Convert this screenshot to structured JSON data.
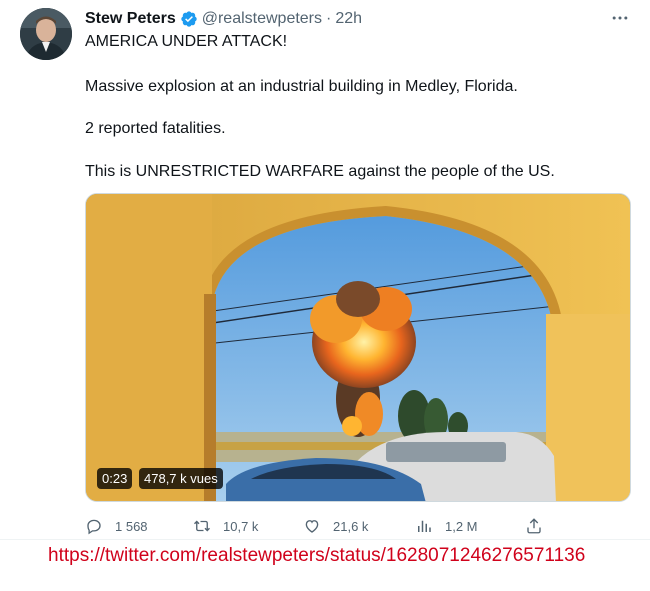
{
  "tweet": {
    "author_name": "Stew Peters",
    "handle": "@realstewpeters",
    "separator": "·",
    "time": "22h",
    "verified": true,
    "lines": [
      "AMERICA UNDER ATTACK!",
      "Massive explosion at an industrial building in Medley, Florida.",
      "2 reported fatalities.",
      "This is UNRESTRICTED WARFARE against the people of the US."
    ],
    "video": {
      "duration": "0:23",
      "views": "478,7 k vues"
    },
    "actions": {
      "replies": "1 568",
      "retweets": "10,7 k",
      "likes": "21,6 k",
      "views": "1,2 M"
    }
  },
  "footer_url": "https://twitter.com/realstewpeters/status/1628071246276571136",
  "colors": {
    "verified": "#1d9bf0",
    "secondary_text": "#536471",
    "url_text": "#d0021b"
  },
  "icons": {
    "more": "more-icon",
    "reply": "reply-icon",
    "retweet": "retweet-icon",
    "like": "like-icon",
    "views": "views-icon",
    "share": "share-icon",
    "verified": "verified-badge-icon"
  }
}
